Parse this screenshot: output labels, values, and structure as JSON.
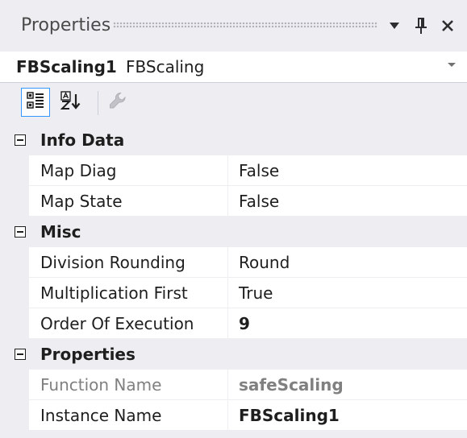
{
  "window": {
    "title": "Properties",
    "dropdown_icon": "chevron-down-icon",
    "pin_icon": "pin-icon",
    "close_icon": "close-icon"
  },
  "object": {
    "name": "FBScaling1",
    "type": "FBScaling"
  },
  "toolbar": {
    "buttons": [
      {
        "icon": "categorized-icon",
        "active": true
      },
      {
        "icon": "alphabetical-sort-icon",
        "active": false
      },
      {
        "icon": "property-pages-wrench-icon",
        "active": false,
        "enabled": false
      }
    ]
  },
  "grid": {
    "categories": [
      {
        "label": "Info Data",
        "expanded": true,
        "properties": [
          {
            "name": "Map Diag",
            "value": "False"
          },
          {
            "name": "Map State",
            "value": "False"
          }
        ]
      },
      {
        "label": "Misc",
        "expanded": true,
        "properties": [
          {
            "name": "Division Rounding",
            "value": "Round"
          },
          {
            "name": "Multiplication First",
            "value": "True"
          },
          {
            "name": "Order Of Execution",
            "value": "9"
          }
        ]
      },
      {
        "label": "Properties",
        "expanded": true,
        "properties": [
          {
            "name": "Function Name",
            "value": "safeScaling"
          },
          {
            "name": "Instance Name",
            "value": "FBScaling1"
          }
        ]
      }
    ]
  },
  "colors": {
    "chrome": "#eeeef2",
    "accent": "#3399ff",
    "readonly_text": "#808080"
  }
}
